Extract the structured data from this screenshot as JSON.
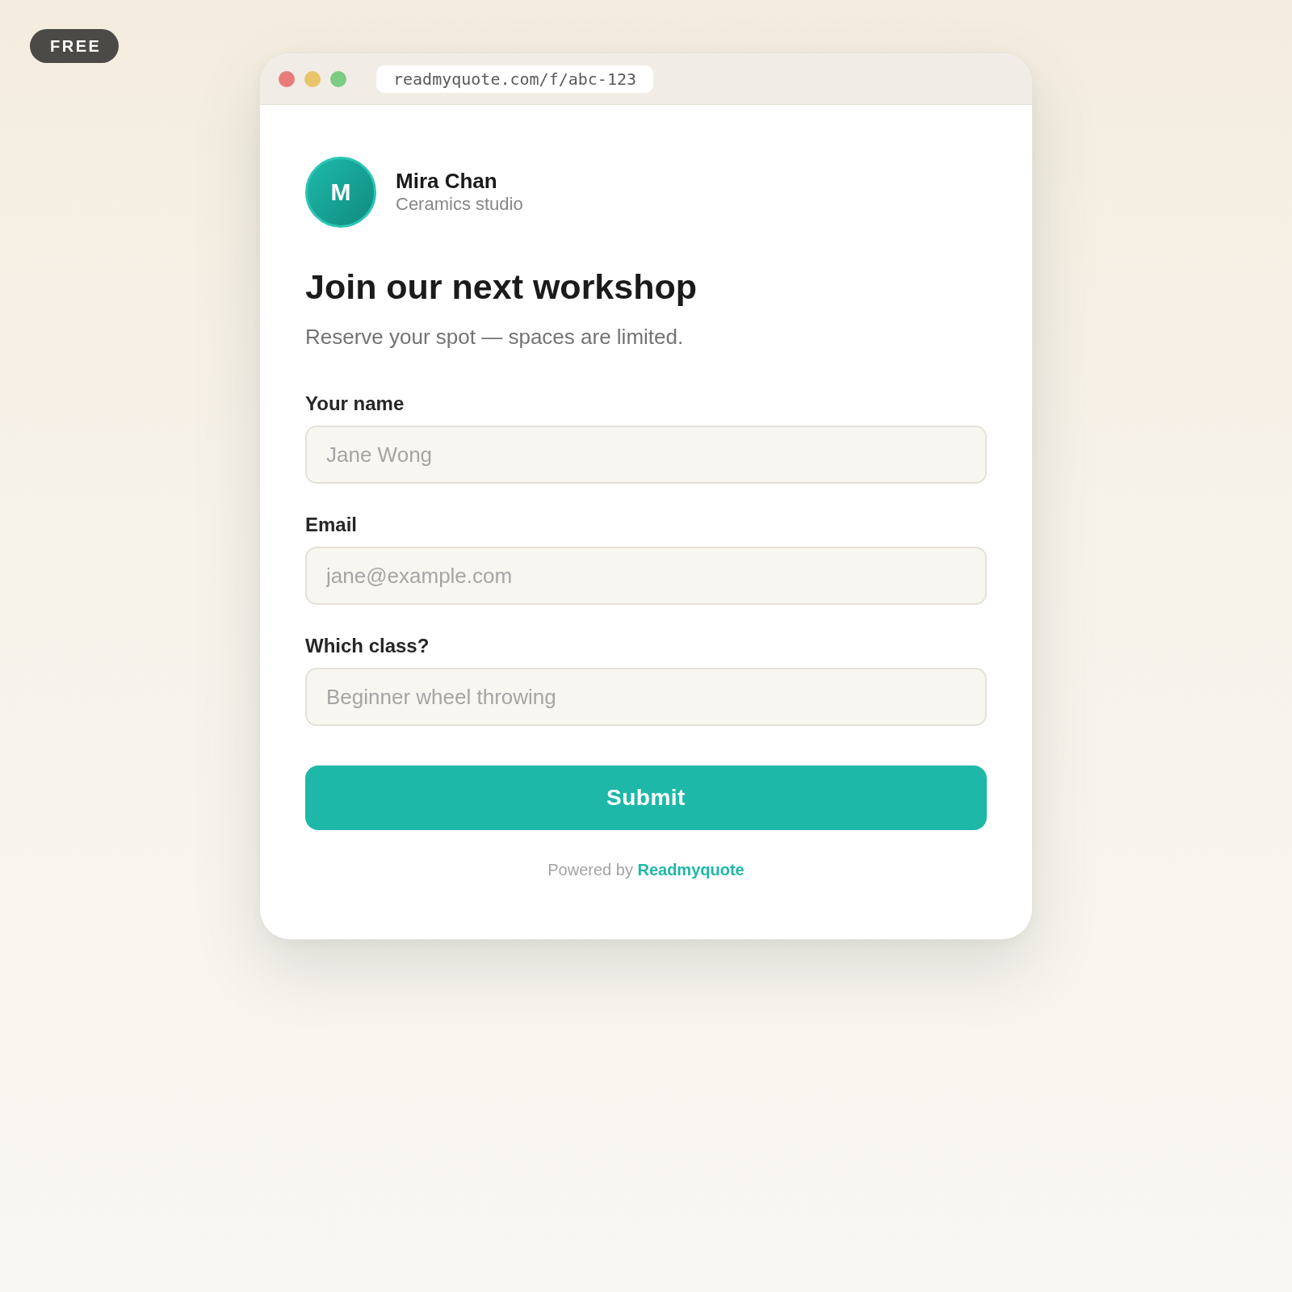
{
  "badge": {
    "label": "FREE"
  },
  "browser": {
    "url": "readmyquote.com/f/abc-123"
  },
  "profile": {
    "initial": "M",
    "name": "Mira Chan",
    "subtitle": "Ceramics studio"
  },
  "form": {
    "title": "Join our next workshop",
    "description": "Reserve your spot — spaces are limited.",
    "fields": [
      {
        "label": "Your name",
        "placeholder": "Jane Wong"
      },
      {
        "label": "Email",
        "placeholder": "jane@example.com"
      },
      {
        "label": "Which class?",
        "placeholder": "Beginner wheel throwing"
      }
    ],
    "submit": {
      "label": "Submit"
    }
  },
  "footer": {
    "prefix": "Powered by",
    "link": "Readmyquote"
  }
}
